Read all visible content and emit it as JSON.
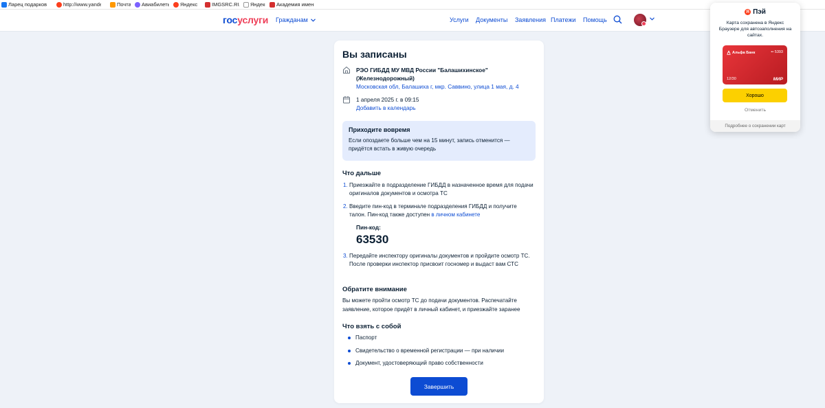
{
  "bookmarks": [
    {
      "label": "Ларец подарков",
      "color": "#1877f2"
    },
    {
      "label": "http://www.yandex",
      "color": "#fc3f1d"
    },
    {
      "label": "Почта",
      "color": "#ff9800"
    },
    {
      "label": "Авиабилеты",
      "color": "#7b61ff"
    },
    {
      "label": "Яндекс",
      "color": "#fc3f1d"
    },
    {
      "label": "IMGSRC.RU",
      "color": "#d32f2f"
    },
    {
      "label": "Яндекс",
      "color": "#999999"
    },
    {
      "label": "Академия имени",
      "color": "#d32f2f"
    }
  ],
  "header": {
    "logo_part1": "гос",
    "logo_part2": "услуги",
    "audience": "Гражданам",
    "nav": [
      "Услуги",
      "Документы",
      "Заявления",
      "Платежи",
      "Помощь"
    ]
  },
  "card": {
    "title": "Вы записаны",
    "org_name": "РЭО ГИБДД МУ МВД России \"Балашихинское\" (Железнодорожный)",
    "org_address": "Московская обл, Балашиха г, мкр. Саввино, улица 1 мая, д. 4",
    "datetime": "1 апреля 2025 г. в 09:15",
    "add_to_calendar": "Добавить в календарь",
    "notice_title": "Приходите вовремя",
    "notice_text": "Если опоздаете больше чем на 15 минут, запись отменится — придётся встать в живую очередь",
    "next_title": "Что дальше",
    "steps": [
      {
        "num": "1.",
        "text": "Приезжайте в подразделение ГИБДД в назначенное время для подачи оригиналов документов и осмотра ТС"
      },
      {
        "num": "2.",
        "text": "Введите пин-код в терминале подразделения ГИБДД и получите талон. Пин-код также доступен ",
        "link": "в личном кабинете"
      },
      {
        "num": "3.",
        "text": "Передайте инспектору оригиналы документов и пройдите осмотр ТС. После проверки инспектор присвоит госномер и выдаст вам СТС"
      }
    ],
    "pin_label": "Пин-код:",
    "pin_code": "63530",
    "attention_title": "Обратите внимание",
    "attention_text": "Вы можете пройти осмотр ТС до подачи документов. Распечатайте заявление, которое придёт в личный кабинет, и приезжайте заранее",
    "bring_title": "Что взять с собой",
    "bring_items": [
      "Паспорт",
      "Свидетельство о временной регистрации — при наличии",
      "Документ, удостоверяющий право собственности"
    ],
    "finish_button": "Завершить"
  },
  "ypay": {
    "badge": "Я",
    "brand": "Пэй",
    "message": "Карта сохранена в Яндекс Браузере для автозаполнения на сайтах.",
    "bank_name": "Альфа Банк",
    "card_number": "•• 5393",
    "card_expiry": "12/30",
    "card_system": "МИР",
    "ok_button": "Хорошо",
    "cancel_button": "Отменить",
    "footer_link": "Подробнее о сохранении карт"
  },
  "colors": {
    "brand_blue": "#0d4cd3",
    "brand_red": "#ee3f58",
    "notice_bg": "#e4ecfd",
    "yandex_yellow": "#fcd000"
  }
}
